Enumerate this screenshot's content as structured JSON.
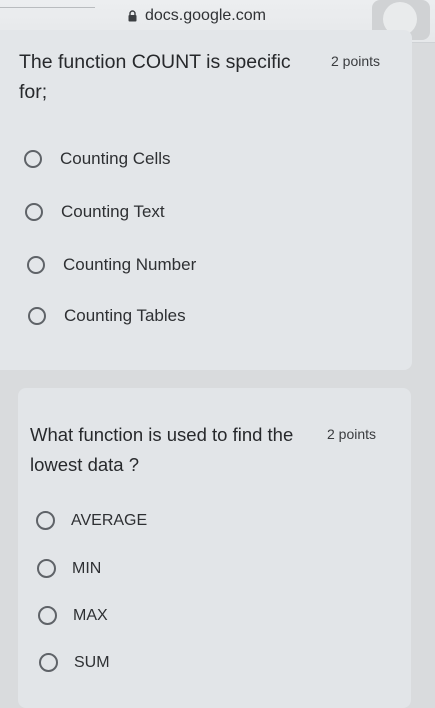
{
  "browser": {
    "url": "docs.google.com"
  },
  "questions": [
    {
      "title": "The function COUNT is specific for;",
      "points": "2 points",
      "options": [
        "Counting Cells",
        "Counting Text",
        "Counting Number",
        "Counting Tables"
      ]
    },
    {
      "title": "What function is used to find the lowest data ?",
      "points": "2 points",
      "options": [
        "AVERAGE",
        "MIN",
        "MAX",
        "SUM"
      ]
    }
  ],
  "icons": {
    "lock": "lock-icon",
    "radio": "radio-unchecked-icon"
  }
}
